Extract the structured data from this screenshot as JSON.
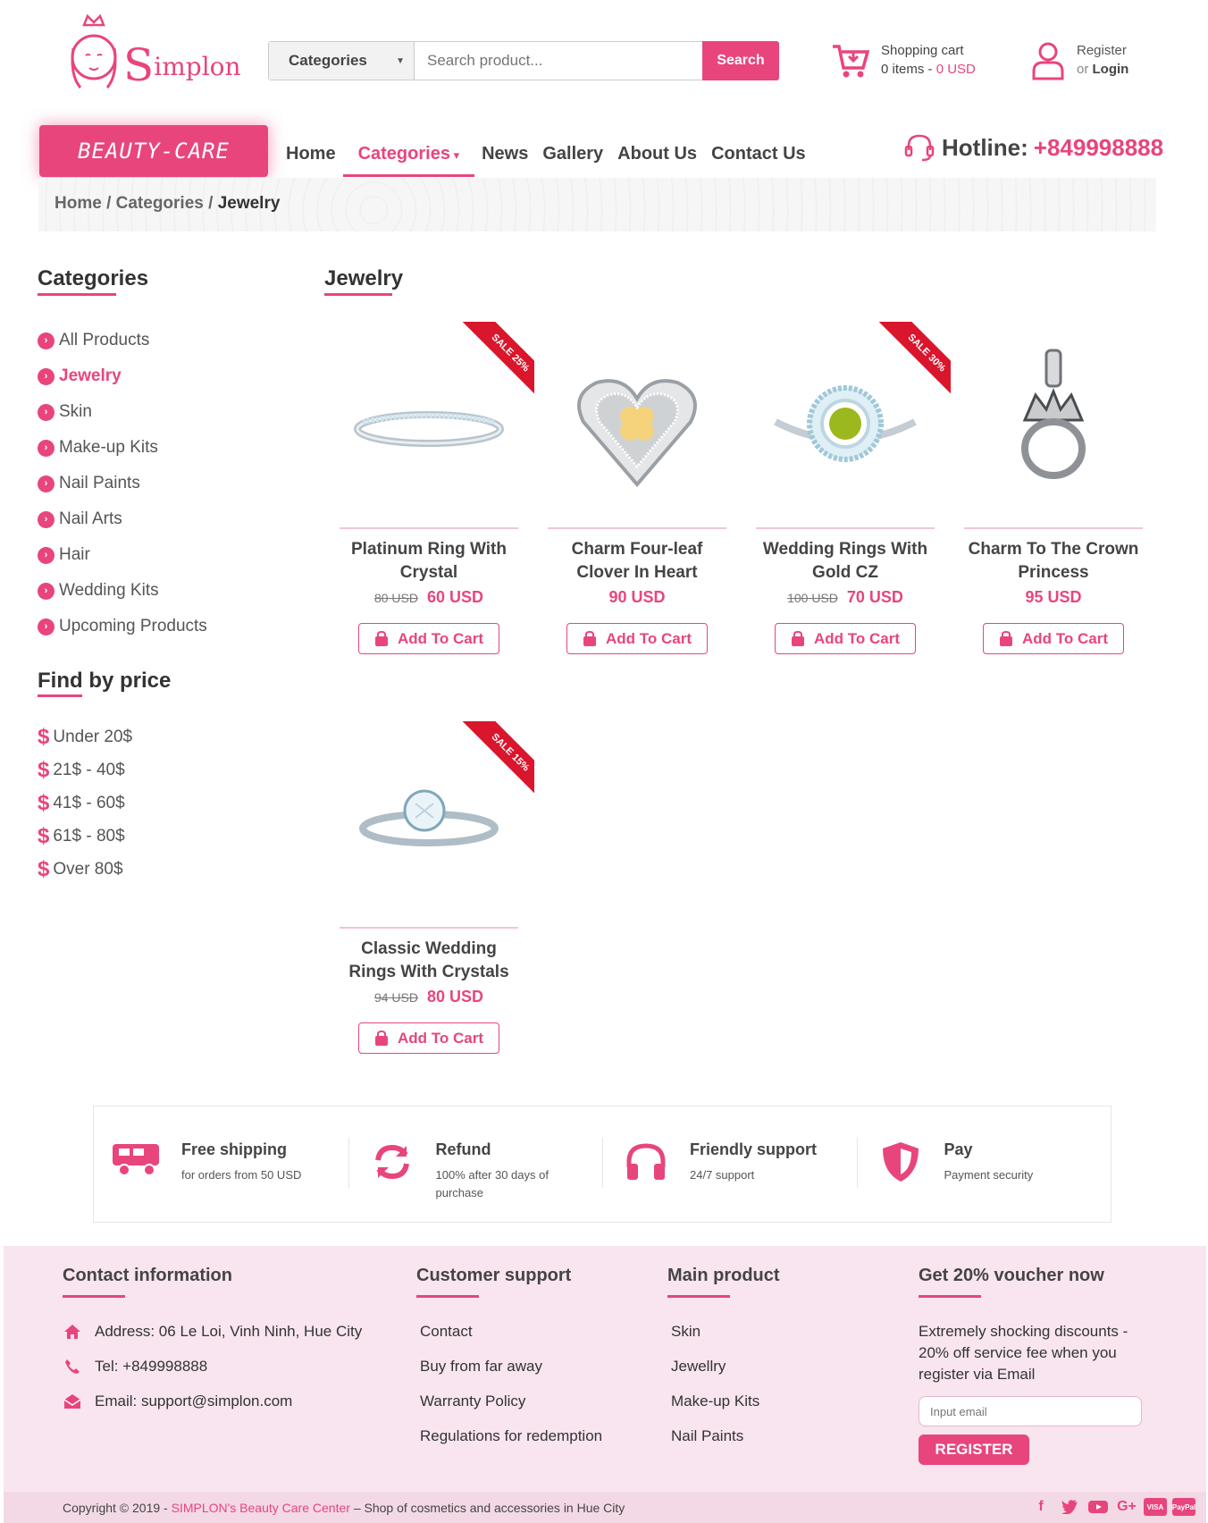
{
  "brand": {
    "name": "Simplon",
    "badge": "BEAUTY-CARE"
  },
  "search": {
    "category": "Categories",
    "placeholder": "Search product...",
    "button": "Search"
  },
  "cart": {
    "title": "Shopping cart",
    "items": "0 items -",
    "total": "0 USD"
  },
  "account": {
    "register": "Register",
    "or": "or",
    "login": "Login"
  },
  "nav": {
    "items": [
      "Home",
      "Categories",
      "News",
      "Gallery",
      "About Us",
      "Contact Us"
    ],
    "active": "Categories"
  },
  "hotline": {
    "label": "Hotline:",
    "number": "+849998888"
  },
  "breadcrumb": {
    "home": "Home",
    "sep1": "/",
    "cat": "Categories",
    "sep2": "/",
    "current": "Jewelry"
  },
  "sidebar": {
    "categories_title": "Categories",
    "categories": [
      "All Products",
      "Jewelry",
      "Skin",
      "Make-up Kits",
      "Nail Paints",
      "Nail Arts",
      "Hair",
      "Wedding Kits",
      "Upcoming Products"
    ],
    "active": "Jewelry",
    "price_title": "Find by price",
    "prices": [
      "Under 20$",
      "21$ - 40$",
      "41$ - 60$",
      "61$ - 80$",
      "Over 80$"
    ]
  },
  "main": {
    "title": "Jewelry",
    "add_to_cart": "Add To Cart"
  },
  "products": [
    {
      "name": "Platinum Ring With Crystal",
      "old_price": "80 USD",
      "price": "60 USD",
      "sale": "SALE 25%"
    },
    {
      "name": "Charm Four-leaf Clover In Heart",
      "old_price": "",
      "price": "90 USD",
      "sale": ""
    },
    {
      "name": "Wedding Rings With Gold CZ",
      "old_price": "100 USD",
      "price": "70 USD",
      "sale": "SALE 30%"
    },
    {
      "name": "Charm To The Crown Princess",
      "old_price": "",
      "price": "95 USD",
      "sale": ""
    },
    {
      "name": "Classic Wedding Rings With Crystals",
      "old_price": "94 USD",
      "price": "80 USD",
      "sale": "SALE 15%"
    }
  ],
  "features": [
    {
      "title": "Free shipping",
      "desc": "for orders from 50 USD",
      "icon": "truck-icon"
    },
    {
      "title": "Refund",
      "desc": "100% after 30 days of purchase",
      "icon": "refresh-icon"
    },
    {
      "title": "Friendly support",
      "desc": "24/7 support",
      "icon": "headphones-icon"
    },
    {
      "title": "Pay",
      "desc": "Payment security",
      "icon": "shield-icon"
    }
  ],
  "footer": {
    "contact_title": "Contact information",
    "address": "Address: 06 Le Loi, Vinh Ninh, Hue City",
    "tel": "Tel: +849998888",
    "email": "Email: support@simplon.com",
    "support_title": "Customer support",
    "support": [
      "Contact",
      "Buy from far away",
      "Warranty Policy",
      "Regulations for redemption"
    ],
    "products_title": "Main product",
    "products": [
      "Skin",
      "Jewellry",
      "Make-up Kits",
      "Nail Paints"
    ],
    "voucher_title": "Get 20% voucher now",
    "voucher_text": "Extremely shocking discounts - 20% off service fee when you register via Email",
    "voucher_placeholder": "Input email",
    "voucher_button": "REGISTER",
    "copy_prefix": "Copyright © 2019 -",
    "copy_brand": "SIMPLON's Beauty Care Center",
    "copy_suffix": "– Shop of cosmetics and accessories in Hue City",
    "social": [
      "f",
      "t",
      "yt",
      "G+",
      "VISA",
      "PayPal"
    ]
  },
  "colors": {
    "accent": "#e8457d",
    "sale": "#d9162c",
    "footer_bg": "#f8e5ef"
  }
}
